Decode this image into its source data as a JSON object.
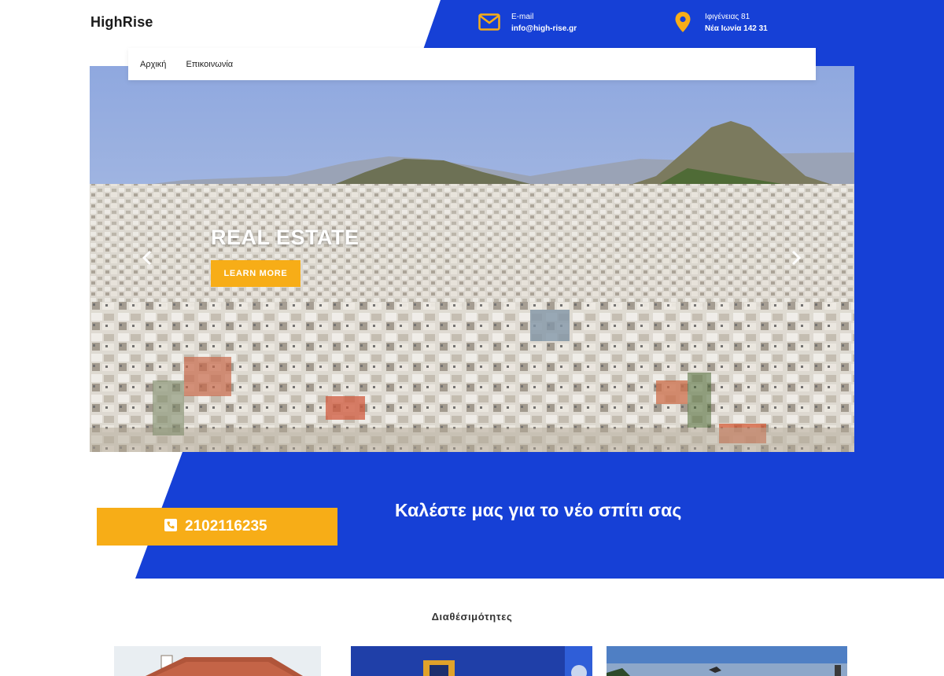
{
  "brand": {
    "logo": "HighRise"
  },
  "contact": {
    "email_label": "E-mail",
    "email_value": "info@high-rise.gr",
    "address_line1": "Ιφιγένειας 81",
    "address_line2": "Νέα Ιωνία 142 31"
  },
  "nav": {
    "items": [
      {
        "label": "Αρχική"
      },
      {
        "label": "Επικοινωνία"
      }
    ]
  },
  "hero": {
    "title": "REAL ESTATE",
    "button_label": "LEARN MORE"
  },
  "cta": {
    "heading": "Καλέστε μας για το νέο σπίτι σας",
    "phone": "2102116235"
  },
  "listings": {
    "title": "Διαθέσιμότητες"
  },
  "colors": {
    "brand_blue": "#1640d6",
    "accent_yellow": "#f7ad17"
  },
  "icons": [
    "envelope-icon",
    "map-pin-icon",
    "chevron-left-icon",
    "chevron-right-icon",
    "phone-icon"
  ]
}
